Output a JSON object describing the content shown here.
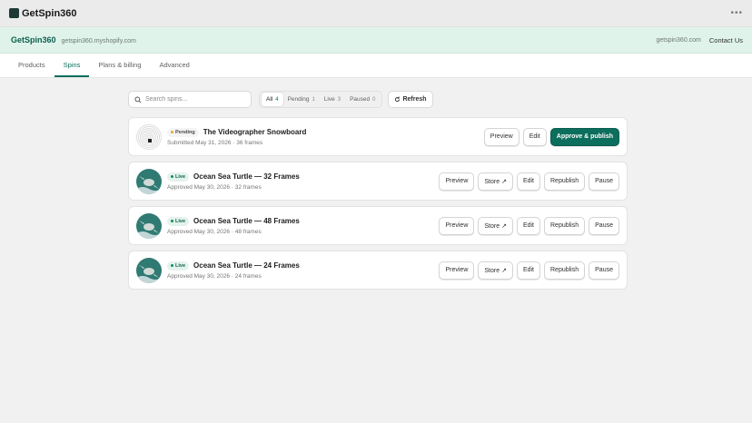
{
  "app": {
    "title": "GetSpin360",
    "more_icon": "more-horizontal-icon"
  },
  "banner": {
    "brand": "GetSpin360",
    "store_domain": "getspin360.myshopify.com",
    "site": "getspin360.com",
    "contact_label": "Contact Us"
  },
  "tabs": [
    {
      "label": "Products",
      "active": false
    },
    {
      "label": "Spins",
      "active": true
    },
    {
      "label": "Plans & billing",
      "active": false
    },
    {
      "label": "Advanced",
      "active": false
    }
  ],
  "toolbar": {
    "search_placeholder": "Search spins...",
    "filters": [
      {
        "label": "All",
        "count": "4",
        "active": true
      },
      {
        "label": "Pending",
        "count": "1",
        "active": false
      },
      {
        "label": "Live",
        "count": "3",
        "active": false
      },
      {
        "label": "Paused",
        "count": "0",
        "active": false
      }
    ],
    "refresh_label": "Refresh"
  },
  "spins": [
    {
      "status": "Pending",
      "title": "The Videographer Snowboard",
      "meta": "Submitted May 31, 2026 · 36 frames",
      "thumb": "snowboard",
      "actions": [
        "Preview",
        "Edit",
        "Approve & publish"
      ]
    },
    {
      "status": "Live",
      "title": "Ocean Sea Turtle — 32 Frames",
      "meta": "Approved May 30, 2026 · 32 frames",
      "thumb": "turtle",
      "actions": [
        "Preview",
        "Store ↗",
        "Edit",
        "Republish",
        "Pause"
      ]
    },
    {
      "status": "Live",
      "title": "Ocean Sea Turtle — 48 Frames",
      "meta": "Approved May 30, 2026 · 48 frames",
      "thumb": "turtle",
      "actions": [
        "Preview",
        "Store ↗",
        "Edit",
        "Republish",
        "Pause"
      ]
    },
    {
      "status": "Live",
      "title": "Ocean Sea Turtle — 24 Frames",
      "meta": "Approved May 30, 2026 · 24 frames",
      "thumb": "turtle",
      "actions": [
        "Preview",
        "Store ↗",
        "Edit",
        "Republish",
        "Pause"
      ]
    }
  ],
  "colors": {
    "accent": "#0c6e5c",
    "banner_bg": "#dff3ea",
    "pending_dot": "#e8a43a",
    "live_dot": "#0f8a66"
  }
}
